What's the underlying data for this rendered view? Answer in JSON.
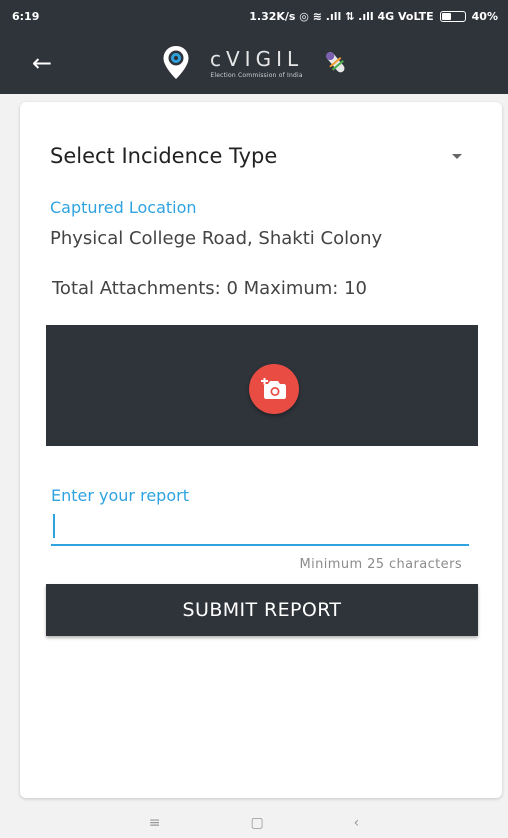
{
  "status_bar": {
    "time": "6:19",
    "indicators": "1.32K/s ◎ ≋ .ıll ⇅ .ıll 4G VoLTE",
    "battery": "40%"
  },
  "app_bar": {
    "back_icon": "arrow-left-icon",
    "brand_name": "cVIGIL",
    "brand_subtitle": "Election Commission of India"
  },
  "form": {
    "incidence_type_label": "Select Incidence Type",
    "captured_location_label": "Captured Location",
    "captured_location_value": "Physical College Road, Shakti Colony",
    "attachments_text": "Total Attachments: 0 Maximum: 10",
    "camera_icon": "add-camera-icon",
    "report_label": "Enter your report",
    "report_value": "",
    "report_hint": "Minimum 25 characters",
    "submit_label": "SUBMIT REPORT"
  },
  "nav_bar": {
    "menu_icon": "≡",
    "home_icon": "▢",
    "back_icon": "‹"
  },
  "colors": {
    "app_bar": "#2f343b",
    "accent": "#2ea3e0",
    "camera_button": "#e84c43"
  }
}
